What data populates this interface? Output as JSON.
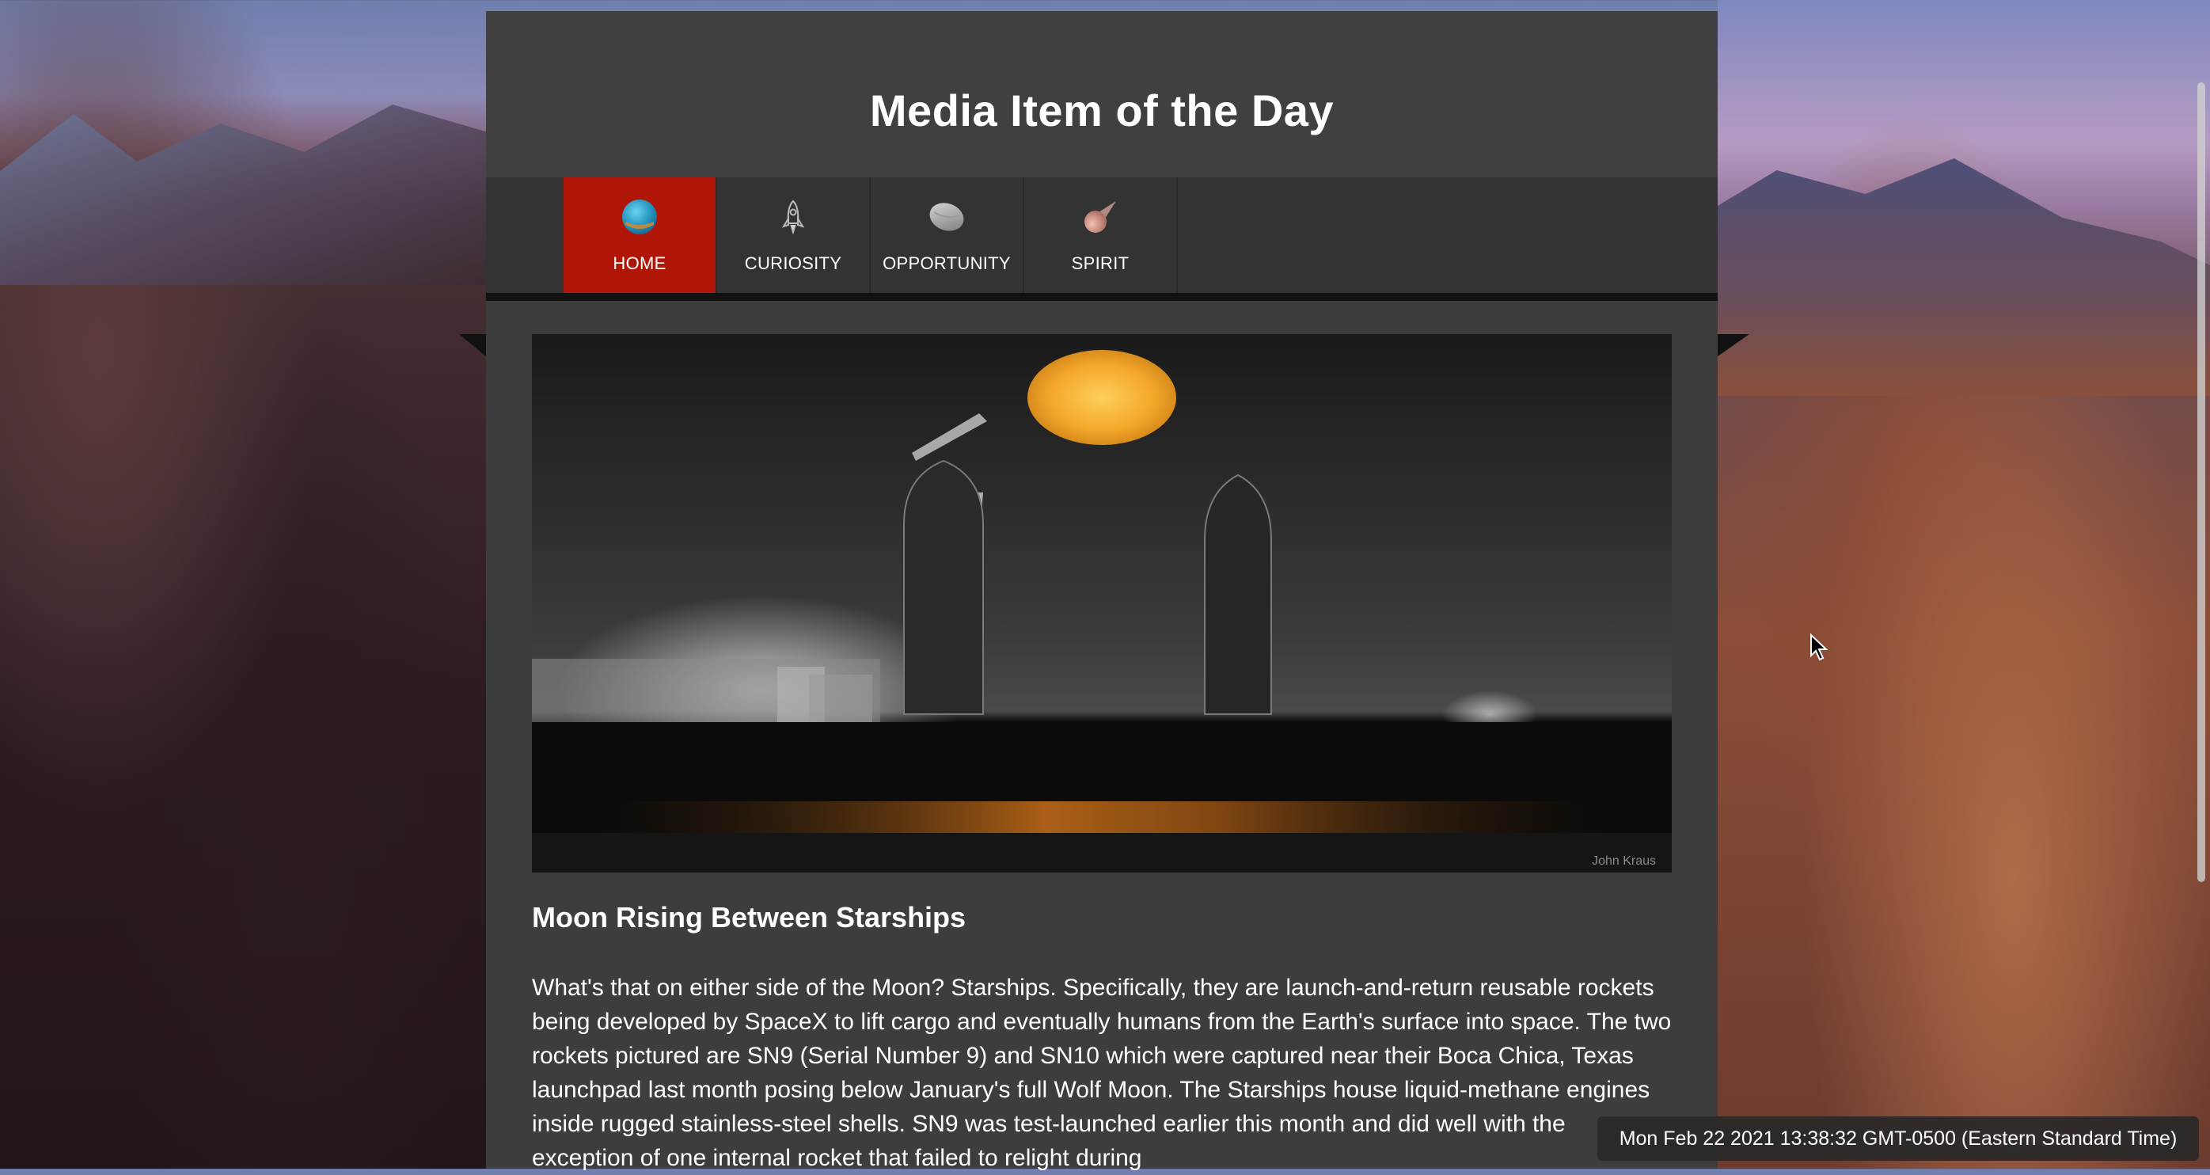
{
  "site": {
    "title": "Media Item of the Day"
  },
  "nav": {
    "items": [
      {
        "label": "HOME",
        "icon": "globe-icon",
        "active": true
      },
      {
        "label": "CURIOSITY",
        "icon": "rocket-icon",
        "active": false
      },
      {
        "label": "OPPORTUNITY",
        "icon": "planet-icon",
        "active": false
      },
      {
        "label": "SPIRIT",
        "icon": "comet-icon",
        "active": false
      }
    ]
  },
  "media": {
    "image_alt": "Starships at night with full moon",
    "credit": "John Kraus",
    "title": "Moon Rising Between Starships",
    "description": "What's that on either side of the Moon? Starships. Specifically, they are launch-and-return reusable rockets being developed by SpaceX to lift cargo and eventually humans from the Earth's surface into space. The two rockets pictured are SN9 (Serial Number 9) and SN10 which were captured near their Boca Chica, Texas launchpad last month posing below January's full Wolf Moon. The Starships house liquid-methane engines inside rugged stainless-steel shells. SN9 was test-launched earlier this month and did well with the exception of one internal rocket that failed to relight during"
  },
  "status": {
    "timestamp": "Mon Feb 22 2021 13:38:32 GMT-0500 (Eastern Standard Time)"
  },
  "colors": {
    "active_nav": "#b01507",
    "panel": "#3d3d3d",
    "nav_bar": "#333333"
  }
}
